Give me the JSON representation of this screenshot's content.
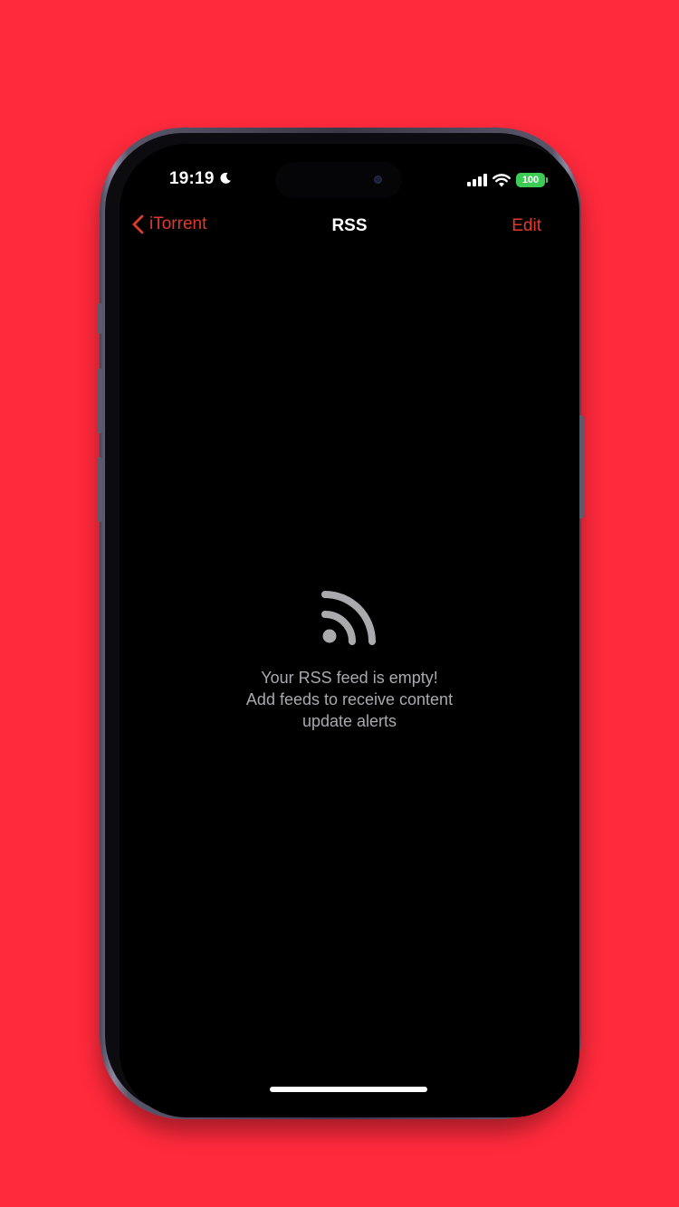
{
  "status_bar": {
    "time": "19:19",
    "moon_icon": "moon-icon",
    "signal_icon": "cellular-signal-icon",
    "wifi_icon": "wifi-icon",
    "battery_level": "100",
    "battery_color": "#3ccb55"
  },
  "nav": {
    "back_label": "iTorrent",
    "title": "RSS",
    "edit_label": "Edit",
    "accent_color": "#e3392c"
  },
  "empty_state": {
    "icon": "rss-icon",
    "line1": "Your RSS feed is empty!",
    "line2": "Add feeds to receive content",
    "line3": "update alerts"
  },
  "background_color": "#ff2a3c"
}
